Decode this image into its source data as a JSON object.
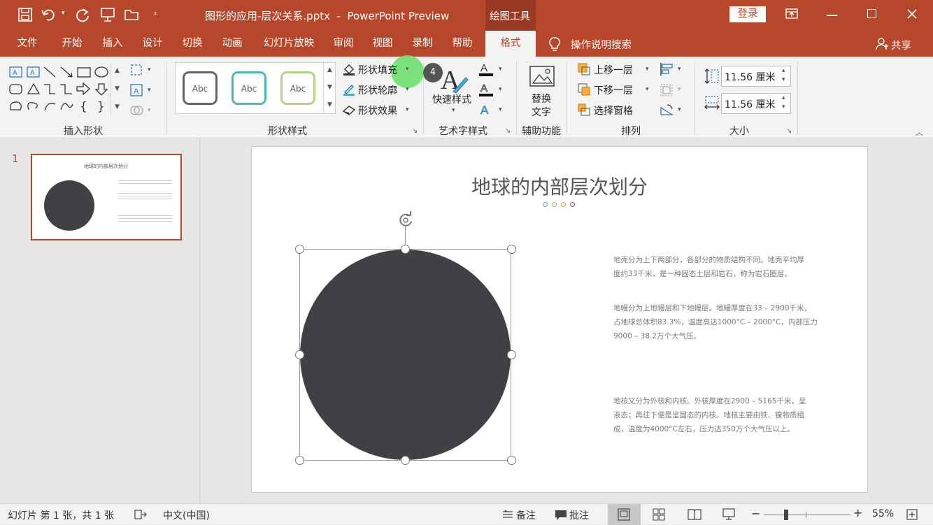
{
  "window": {
    "title": "图形的应用-层次关系.pptx  -  PowerPoint Preview",
    "context_tab": "绘图工具",
    "login_button": "登录"
  },
  "tabs": [
    "文件",
    "开始",
    "插入",
    "设计",
    "切换",
    "动画",
    "幻灯片放映",
    "审阅",
    "视图",
    "录制",
    "帮助",
    "格式"
  ],
  "active_tab": "格式",
  "tell_me": "操作说明搜索",
  "share": "共享",
  "ribbon": {
    "insert_shapes_label": "插入形状",
    "shape_styles_label": "形状样式",
    "style_samples": [
      "Abc",
      "Abc",
      "Abc"
    ],
    "shape_fill": "形状填充",
    "shape_outline": "形状轮廓",
    "shape_effects": "形状效果",
    "wordart_label": "艺术字样式",
    "quick_styles": "快速样式",
    "accessibility_label": "辅助功能",
    "alt_text_line1": "替换",
    "alt_text_line2": "文字",
    "arrange_label": "排列",
    "bring_forward": "上移一层",
    "send_backward": "下移一层",
    "selection_pane": "选择窗格",
    "size_label": "大小",
    "height_value": "11.56 厘米",
    "width_value": "11.56 厘米"
  },
  "step_badge": "4",
  "thumbnail": {
    "number": "1",
    "title": "地球的内部层次划分"
  },
  "slide": {
    "title": "地球的内部层次划分",
    "dot_colors": [
      "#4bacc6",
      "#9bbb59",
      "#f79646",
      "#c0504d"
    ],
    "circle_color": "#414044",
    "para1_l1": "地壳分为上下两部分，各部分的物质结构不同。地壳平均厚",
    "para1_l2": "度约33千米，是一种固态土层和岩石，称为岩石圈层。",
    "para2_l1": "地幔分为上地幔层和下地幔层。地幔厚度在33 – 2900千米，",
    "para2_l2": "占地球总体积83.3%，温度高达1000°C – 2000°C，内部压力",
    "para2_l3": "9000 – 38.2万个大气压。",
    "para3_l1": "地核又分为外核和内核。外核厚度在2900 – 5165千米，呈",
    "para3_l2": "液态；再往下便是呈固态的内核。地核主要由铁、镍物质组",
    "para3_l3": "成，温度为4000°C左右，压力达350万个大气压以上。"
  },
  "status": {
    "slide_info": "幻灯片 第 1 张，共 1 张",
    "language": "中文(中国)",
    "notes": "备注",
    "comments": "批注",
    "zoom": "55%"
  },
  "colors": {
    "accent": "#b7472a",
    "fill_highlight": "#6ee06e"
  }
}
